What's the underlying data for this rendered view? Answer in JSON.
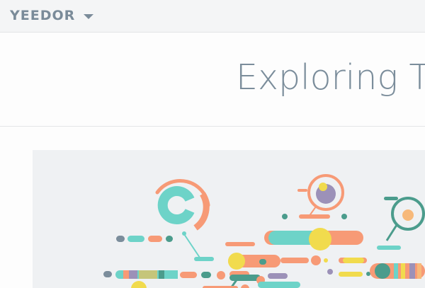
{
  "header": {
    "brand": "YEEDOR",
    "menu_icon": "chevron-down-icon"
  },
  "hero": {
    "title": "Exploring T"
  },
  "article": {
    "hero_image": "abstract-data-art",
    "colors": {
      "teal": "#6dd3c8",
      "salmon": "#f79a76",
      "yellow": "#f1db4d",
      "green": "#4b9c8c",
      "purple": "#9c91b8",
      "slate": "#7b8d9b"
    }
  }
}
